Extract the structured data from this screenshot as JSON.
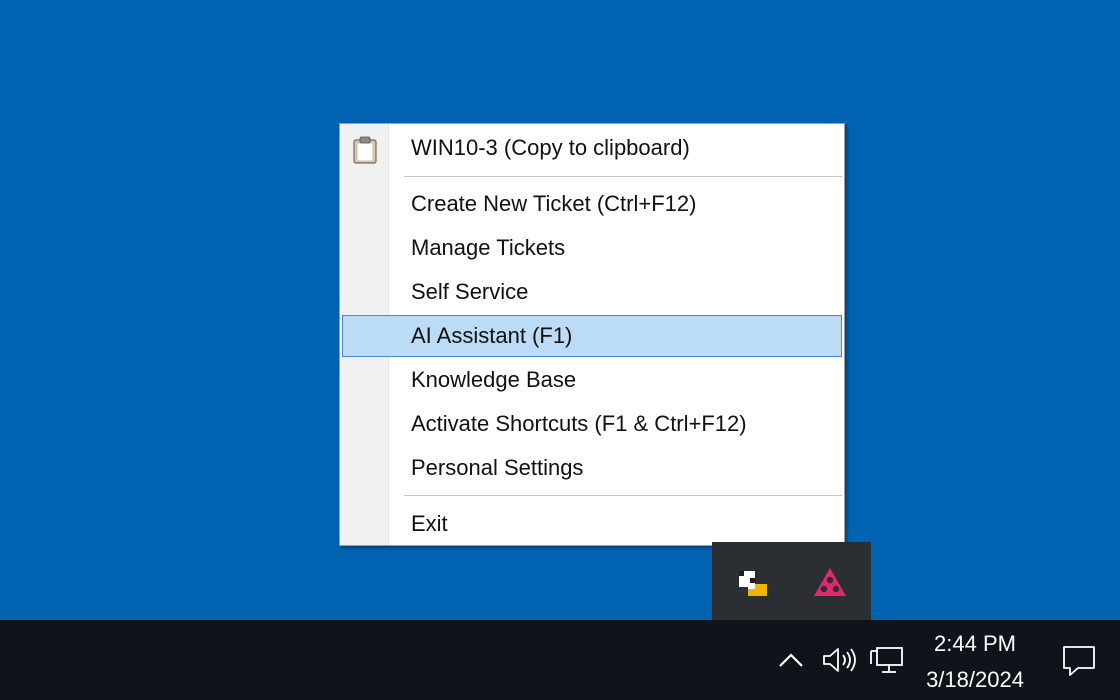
{
  "desktop": {
    "background_color": "#0063b1"
  },
  "context_menu": {
    "clipboard_item": {
      "label": "WIN10-3 (Copy to clipboard)",
      "icon": "clipboard-icon"
    },
    "items": [
      {
        "label": "Create New Ticket (Ctrl+F12)"
      },
      {
        "label": "Manage Tickets"
      },
      {
        "label": "Self Service"
      },
      {
        "label": "AI Assistant (F1)",
        "highlighted": true
      },
      {
        "label": "Knowledge Base"
      },
      {
        "label": "Activate Shortcuts (F1 & Ctrl+F12)"
      },
      {
        "label": "Personal Settings"
      }
    ],
    "exit_item": {
      "label": "Exit"
    },
    "highlight_color": "#bcdcf5",
    "highlight_border_color": "#3c8fd6"
  },
  "tray_flyout": {
    "icons": [
      "helpdesk-app-icon",
      "pink-triangle-app-icon"
    ],
    "pink_icon_color": "#e0286e"
  },
  "taskbar": {
    "icons": [
      "chevron-up-icon",
      "volume-icon",
      "network-icon",
      "notification-icon"
    ],
    "clock": {
      "time": "2:44 PM",
      "date": "3/18/2024"
    }
  }
}
